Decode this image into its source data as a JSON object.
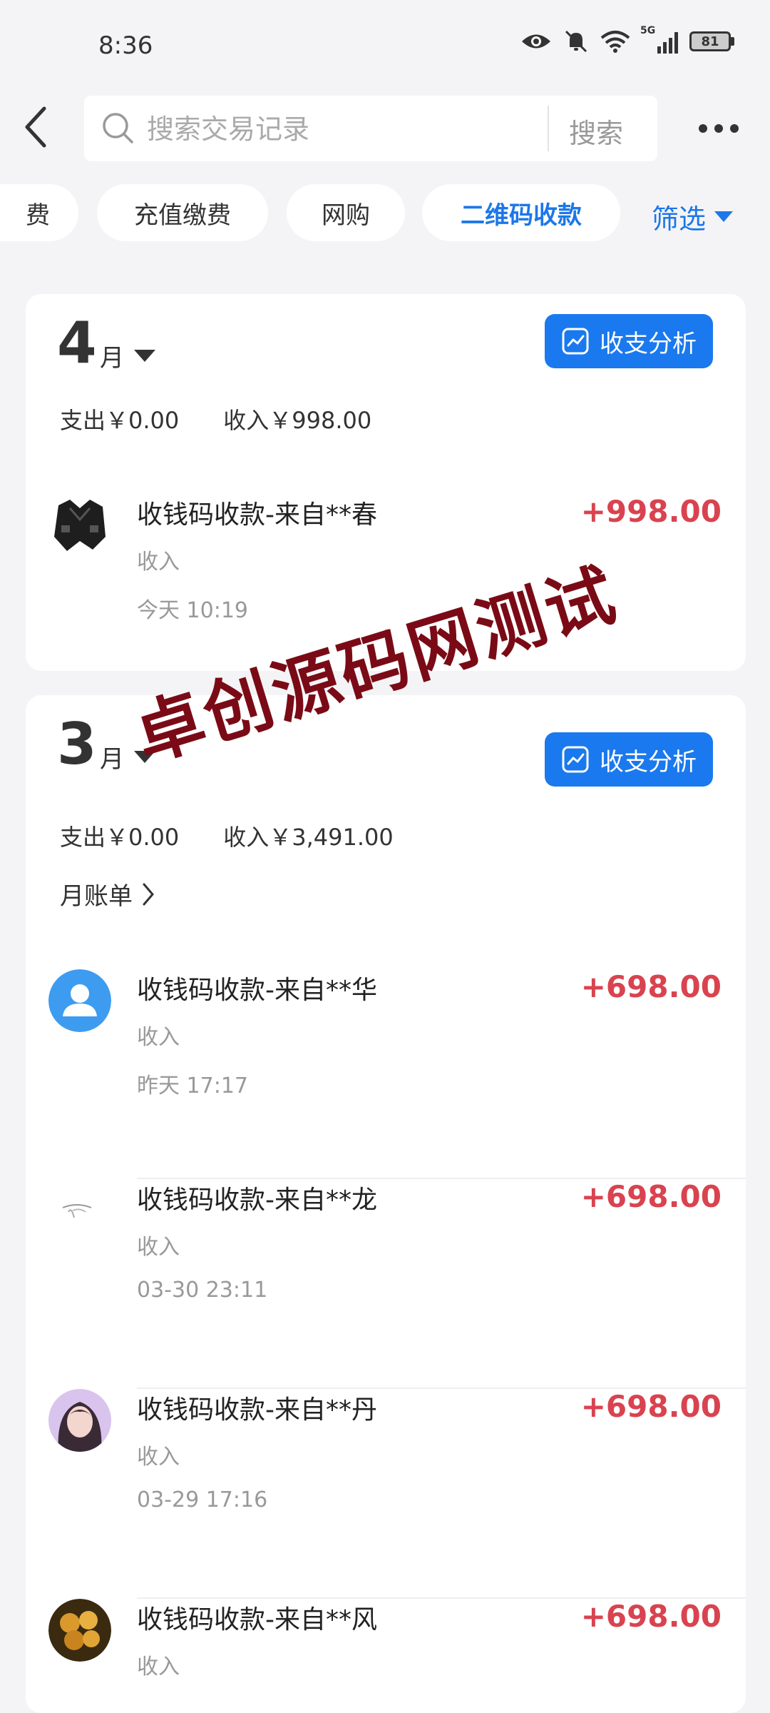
{
  "status_bar": {
    "time": "8:36",
    "network": "5G",
    "battery": "81"
  },
  "search": {
    "placeholder": "搜索交易记录",
    "button_label": "搜索"
  },
  "filters": {
    "chips": [
      "费",
      "充值缴费",
      "网购",
      "二维码收款"
    ],
    "active_chip": "二维码收款",
    "filter_label": "筛选"
  },
  "months": [
    {
      "month": "4",
      "unit": "月",
      "analysis_label": "收支分析",
      "expense": "支出￥0.00",
      "income": "收入￥998.00",
      "transactions": [
        {
          "title": "收钱码收款-来自**春",
          "type": "收入",
          "time": "今天 10:19",
          "amount": "+998.00"
        }
      ]
    },
    {
      "month": "3",
      "unit": "月",
      "analysis_label": "收支分析",
      "expense": "支出￥0.00",
      "income": "收入￥3,491.00",
      "bill_label": "月账单",
      "transactions": [
        {
          "title": "收钱码收款-来自**华",
          "type": "收入",
          "time": "昨天 17:17",
          "amount": "+698.00"
        },
        {
          "title": "收钱码收款-来自**龙",
          "type": "收入",
          "time": "03-30 23:11",
          "amount": "+698.00"
        },
        {
          "title": "收钱码收款-来自**丹",
          "type": "收入",
          "time": "03-29 17:16",
          "amount": "+698.00"
        },
        {
          "title": "收钱码收款-来自**风",
          "type": "收入",
          "time": "",
          "amount": "+698.00"
        }
      ]
    }
  ],
  "watermark": "卓创源码网测试",
  "colors": {
    "accent": "#1a79ee",
    "income": "#d9434f",
    "watermark": "#7a0b16"
  }
}
